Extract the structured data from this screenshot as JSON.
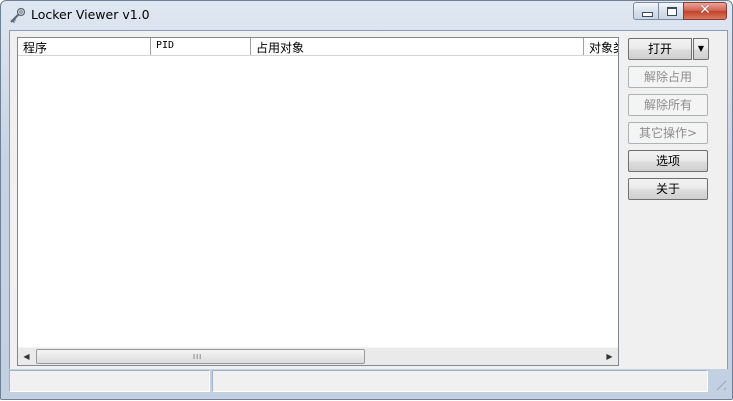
{
  "window": {
    "title": "Locker Viewer v1.0",
    "icon": "key-icon",
    "controls": {
      "minimize": "minimize-icon",
      "maximize": "maximize-icon",
      "close_glyph": "✕"
    }
  },
  "list": {
    "columns": [
      "程序",
      "PID",
      "占用对象",
      "对象类"
    ],
    "rows": [],
    "hscroll": {
      "left_arrow": "◀",
      "right_arrow": "▶",
      "grip": "III"
    }
  },
  "buttons": {
    "open": "打开",
    "open_dropdown": "▼",
    "unlock": "解除占用",
    "unlock_all": "解除所有",
    "other_ops": "其它操作>",
    "options": "选项",
    "about": "关于"
  },
  "status": {
    "left": "",
    "right": ""
  },
  "colors": {
    "accent_close": "#c2412c",
    "client_bg": "#f0f0f0",
    "frame": "#c6d3e3"
  }
}
